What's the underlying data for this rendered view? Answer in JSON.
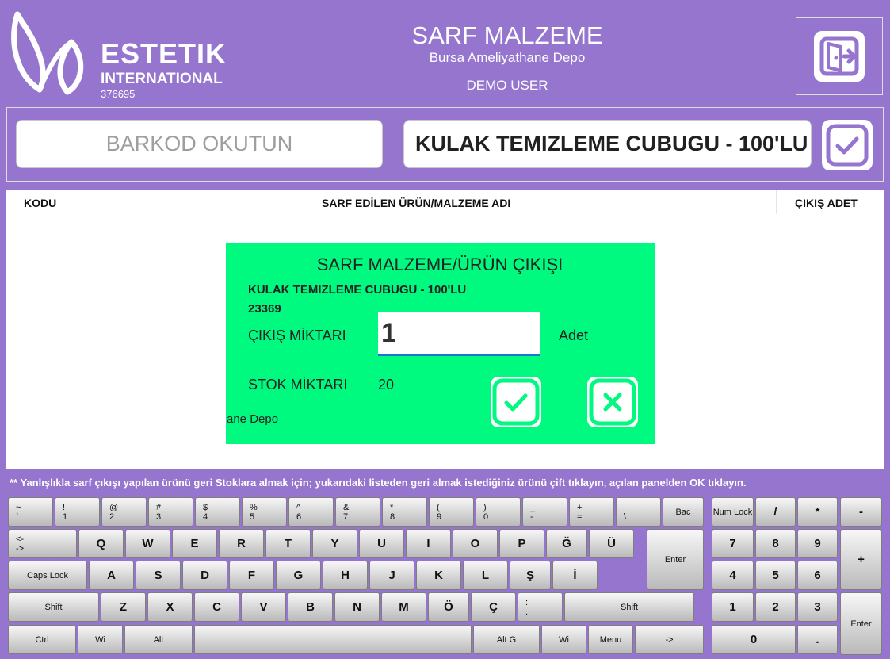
{
  "header": {
    "brand_line1": "ESTETIK",
    "brand_line2": "INTERNATIONAL",
    "brand_code": "376695",
    "title": "SARF MALZEME",
    "subtitle": "Bursa Ameliyathane Depo",
    "user": "DEMO USER",
    "exit_icon": "exit-door-icon"
  },
  "scan": {
    "barcode_placeholder": "BARKOD OKUTUN",
    "product_value": "KULAK TEMIZLEME CUBUGU - 100'LU",
    "confirm_icon": "check-icon"
  },
  "table": {
    "columns": [
      "KODU",
      "SARF EDİLEN ÜRÜN/MALZEME ADI",
      "ÇIKIŞ ADET"
    ]
  },
  "dialog": {
    "title": "SARF MALZEME/ÜRÜN ÇIKIŞI",
    "product_name": "KULAK TEMIZLEME CUBUGU - 100'LU",
    "product_code": "23369",
    "qty_label": "ÇIKIŞ MİKTARI",
    "qty_value": "1",
    "unit": "Adet",
    "stock_label": "STOK MİKTARI",
    "stock_value": "20",
    "depo_fragment": "ane Depo",
    "ok_icon": "check-icon",
    "cancel_icon": "close-icon"
  },
  "note": "** Yanlışlıkla sarf çıkışı yapılan ürünü geri Stoklara almak için; yukarıdaki listeden geri almak istediğiniz ürünü çift tıklayın, açılan panelden OK tıklayın.",
  "colors": {
    "background": "#9575cd",
    "dialog": "#00fa80",
    "input_underline": "#1976d2"
  },
  "keyboard": {
    "row1": [
      [
        "~",
        "`"
      ],
      [
        "!",
        "1 |"
      ],
      [
        "@",
        "2"
      ],
      [
        "#",
        "3"
      ],
      [
        "$",
        "4"
      ],
      [
        "%",
        "5"
      ],
      [
        "^",
        "6"
      ],
      [
        "&",
        "7"
      ],
      [
        "*",
        "8"
      ],
      [
        "(",
        "9"
      ],
      [
        ")",
        "0"
      ],
      [
        "_",
        "-"
      ],
      [
        "+",
        "="
      ],
      [
        "|",
        "\\"
      ]
    ],
    "backspace": "Bac",
    "tab_top": "<-",
    "tab_bottom": "->",
    "row2": [
      "Q",
      "W",
      "E",
      "R",
      "T",
      "Y",
      "U",
      "I",
      "O",
      "P",
      "Ğ",
      "Ü"
    ],
    "enter": "Enter",
    "caps": "Caps Lock",
    "row3": [
      "A",
      "S",
      "D",
      "F",
      "G",
      "H",
      "J",
      "K",
      "L",
      "Ş",
      "İ"
    ],
    "shift": "Shift",
    "row4": [
      "Z",
      "X",
      "C",
      "V",
      "B",
      "N",
      "M",
      "Ö",
      "Ç"
    ],
    "colon_top": ":",
    "colon_bottom": ".",
    "ctrl": "Ctrl",
    "win": "Wi",
    "alt": "Alt",
    "altgr": "Alt G",
    "menu": "Menu",
    "arrow": "->",
    "numlock": "Num Lock",
    "num_slash": "/",
    "num_star": "*",
    "num_minus": "-",
    "num_plus": "+",
    "num_enter": "Enter",
    "num_dot": ".",
    "num_row1": [
      "7",
      "8",
      "9"
    ],
    "num_row2": [
      "4",
      "5",
      "6"
    ],
    "num_row3": [
      "1",
      "2",
      "3"
    ],
    "num_zero": "0"
  }
}
